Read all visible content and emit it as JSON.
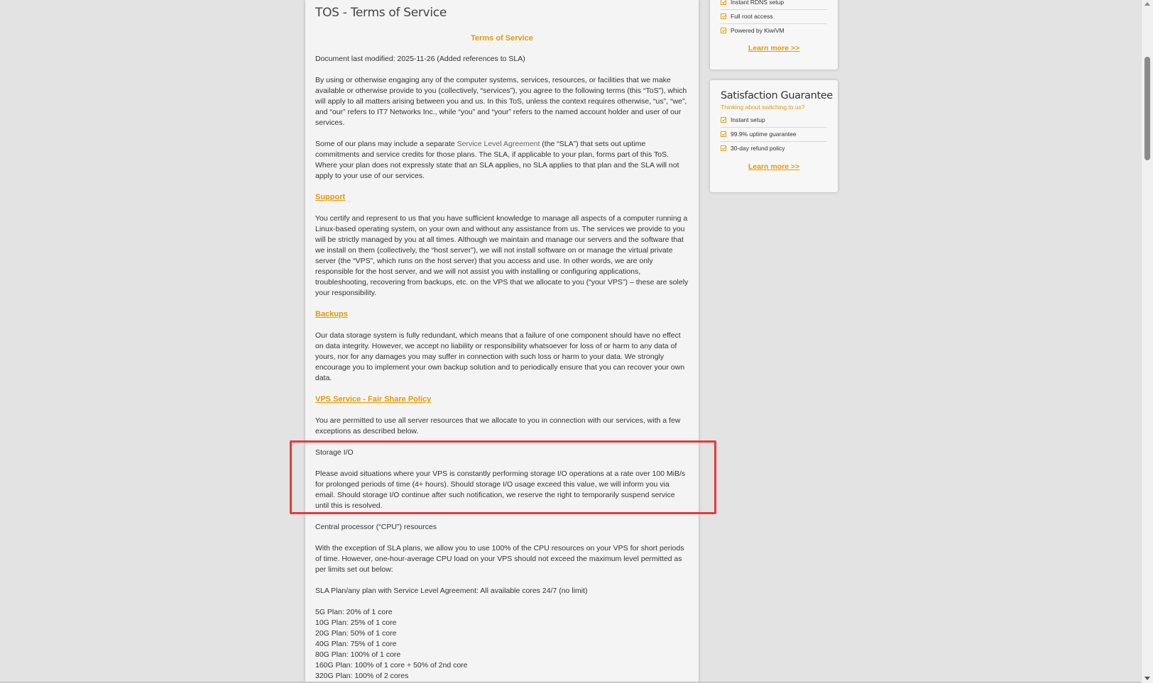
{
  "page": {
    "title": "TOS - Terms of Service",
    "heading": "Terms of Service",
    "last_modified": "Document last modified: 2025-11-26 (Added references to SLA)",
    "intro": "By using or otherwise engaging any of the computer systems, services, resources, or facilities that we make available or otherwise provide to you (collectively, “services”), you agree to the following terms (this “ToS”), which will apply to all matters arising between you and us. In this ToS, unless the context requires otherwise, “us”, “we”, and “our” refers to IT7 Networks Inc., while “you” and “your” refers to the named account holder and user of our services.",
    "sla_para_before": "Some of our plans may include a separate ",
    "sla_link": "Service Level Agreement",
    "sla_para_after": " (the “SLA”) that sets out uptime commitments and service credits for those plans. The SLA, if applicable to your plan, forms part of this ToS. Where your plan does not expressly state that an SLA applies, no SLA applies to that plan and the SLA will not apply to your use of our services.",
    "support_link": "Support",
    "support_para": "You certify and represent to us that you have sufficient knowledge to manage all aspects of a computer running a Linux-based operating system, on your own and without any assistance from us. The services we provide to you will be strictly managed by you at all times. Although we maintain and manage our servers and the software that we install on them (collectively, the “host server”), we will not install software on or manage the virtual private server (the “VPS”, which runs on the host server) that you access and use. In other words, we are only responsible for the host server, and we will not assist you with installing or configuring applications, troubleshooting, recovering from backups, etc. on the VPS that we allocate to you (“your VPS”) – these are solely your responsibility.",
    "backups_link": "Backups",
    "backups_para": "Our data storage system is fully redundant, which means that a failure of one component should have no effect on data integrity. However, we accept no liability or responsibility whatsoever for loss of or harm to any data of yours, nor for any damages you may suffer in connection with such loss or harm to your data. We strongly encourage you to implement your own backup solution and to periodically ensure that you can recover your own data.",
    "fair_share_link": "VPS Service - Fair Share Policy",
    "fair_share_para": "You are permitted to use all server resources that we allocate to you in connection with our services, with a few exceptions as described below.",
    "storage_heading": "Storage I/O",
    "storage_para": "Please avoid situations where your VPS is constantly performing storage I/O operations at a rate over 100 MiB/s for prolonged periods of time (4+ hours). Should storage I/O usage exceed this value, we will inform you via email. Should storage I/O continue after such notification, we reserve the right to temporarily suspend service until this is resolved.",
    "cpu_heading": "Central processor (“CPU”) resources",
    "cpu_para": "With the exception of SLA plans, we allow you to use 100% of the CPU resources on your VPS for short periods of time. However, one-hour-average CPU load on your VPS should not exceed the maximum level permitted as per limits set out below:",
    "sla_plan_line": "SLA Plan/any plan with Service Level Agreement: All available cores 24/7 (no limit)",
    "plans": [
      "5G Plan: 20% of 1 core",
      "10G Plan: 25% of 1 core",
      "20G Plan: 50% of 1 core",
      "40G Plan: 75% of 1 core",
      "80G Plan: 100% of 1 core",
      "160G Plan: 100% of 1 core + 50% of 2nd core",
      "320G Plan: 100% of 2 cores"
    ]
  },
  "sidebar": {
    "box1": {
      "items": [
        "Instant RDNS setup",
        "Full root access",
        "Powered by KiwiVM"
      ],
      "learn_more": "Learn more >>"
    },
    "box2": {
      "title": "Satisfaction Guarantee",
      "subtitle": "Thinking about switching to us?",
      "items": [
        "Instant setup",
        "99.9% uptime guarantee",
        "30-day refund policy"
      ],
      "learn_more": "Learn more >>"
    }
  },
  "colors": {
    "accent": "#e39a07",
    "highlight": "#e8393b"
  }
}
